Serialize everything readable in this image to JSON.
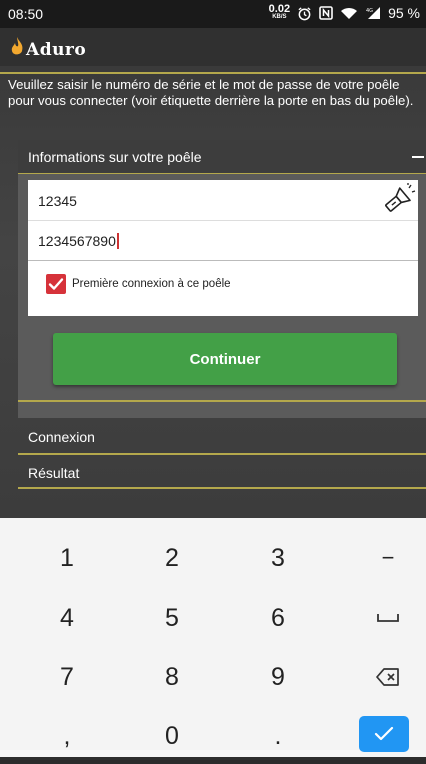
{
  "status_bar": {
    "time": "08:50",
    "net_speed_value": "0.02",
    "net_speed_unit": "KB/S",
    "battery": "95 %",
    "icons": [
      "alarm-icon",
      "nfc-icon",
      "wifi-icon",
      "signal-4g-icon"
    ]
  },
  "app": {
    "logo_text": "Aduro",
    "accent_color": "#b4a84c"
  },
  "instructions": "Veuillez saisir le numéro de série et le mot de passe de votre poêle pour vous connecter (voir étiquette derrière la porte en bas du poêle).",
  "stove_section": {
    "title": "Informations sur votre poêle",
    "collapse_symbol": "−",
    "serial_value": "12345",
    "password_value": "1234567890",
    "first_connection_label": "Première connexion à ce poêle",
    "first_connection_checked": true,
    "continue_label": "Continuer",
    "continue_color": "#43a047"
  },
  "sections": {
    "connexion": "Connexion",
    "resultat": "Résultat"
  },
  "keyboard": {
    "rows": [
      [
        "1",
        "2",
        "3",
        "−"
      ],
      [
        "4",
        "5",
        "6",
        "␣"
      ],
      [
        "7",
        "8",
        "9",
        "⌫"
      ],
      [
        ",",
        "0",
        ".",
        "✓"
      ]
    ],
    "done_color": "#2196f3"
  }
}
